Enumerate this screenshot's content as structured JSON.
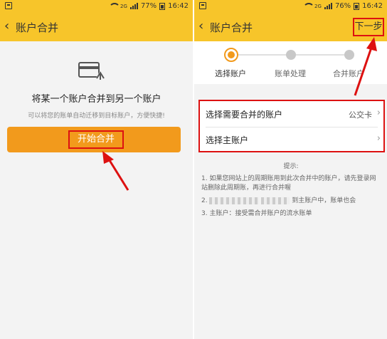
{
  "left": {
    "status": {
      "signal": "2G",
      "battery": "77%",
      "time": "16:42"
    },
    "title": "账户合并",
    "headline": "将某一个账户合并到另一个账户",
    "subline": "可以将您的账单自动迁移到目标账户，方便快捷!",
    "start_button": "开始合并"
  },
  "right": {
    "status": {
      "signal": "2G",
      "battery": "76%",
      "time": "16:42"
    },
    "title": "账户合并",
    "next_button": "下一步",
    "steps": [
      "选择账户",
      "账单处理",
      "合并账户"
    ],
    "rows": {
      "merge_account_label": "选择需要合并的账户",
      "merge_account_value": "公交卡",
      "main_account_label": "选择主账户"
    },
    "tips": {
      "title": "提示:",
      "line1": "1. 如果您网站上的周期账用到此次合并中的账户，请先登录网站删除此周期账，再进行合并喔",
      "line2_prefix": "2.",
      "line2_suffix": "到主账户中，账单也会",
      "line3": "3. 主账户：接受需合并账户的流水账单"
    }
  },
  "colors": {
    "accent": "#f7c52a",
    "button": "#f29a1c",
    "highlight": "#dd1111"
  },
  "icons": [
    "merge-card-icon",
    "back-chevron-icon",
    "wifi-icon",
    "signal-icon",
    "battery-icon",
    "chevron-right-icon"
  ]
}
